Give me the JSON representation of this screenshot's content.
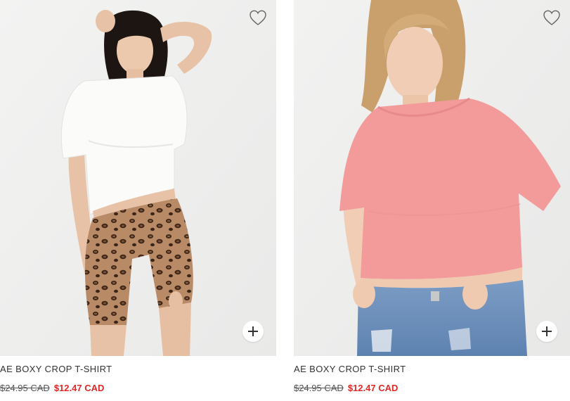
{
  "products": [
    {
      "name": "AE BOXY CROP T-SHIRT",
      "price_original": "$24.95 CAD",
      "price_sale": "$12.47 CAD",
      "top_color": "white",
      "wishlist_icon": "heart-outline-icon",
      "add_icon": "plus-icon"
    },
    {
      "name": "AE BOXY CROP T-SHIRT",
      "price_original": "$24.95 CAD",
      "price_sale": "$12.47 CAD",
      "top_color": "pink",
      "wishlist_icon": "heart-outline-icon",
      "add_icon": "plus-icon"
    }
  ],
  "colors": {
    "sale_price": "#e02826",
    "text": "#333333",
    "photo_background": "#f0f0ef"
  }
}
